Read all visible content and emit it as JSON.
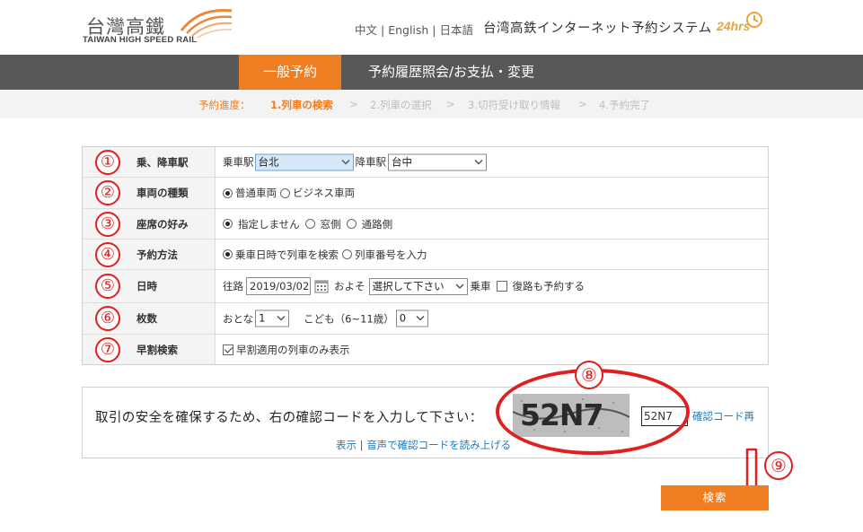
{
  "header": {
    "logo_cn": "台灣高鐵",
    "logo_en": "TAIWAN HIGH SPEED RAIL",
    "lang_zh": "中文",
    "lang_en": "English",
    "lang_ja": "日本語",
    "lang_sep": " | ",
    "system_title": "台湾高鉄インターネット予約システム",
    "hrs_badge": "24hrs"
  },
  "nav": {
    "active_tab": "一般予約",
    "other_tab": "予約履歴照会/お支払・変更"
  },
  "steps": {
    "label": "予約進度：",
    "step1": "1.列車の検索",
    "step2": "2.列車の選択",
    "step3": "3.切符受け取り情報",
    "step4": "4.予約完了",
    "separator": ">"
  },
  "form": {
    "rows": [
      {
        "num": "①",
        "label": "乗、降車駅"
      },
      {
        "num": "②",
        "label": "車両の種類"
      },
      {
        "num": "③",
        "label": "座席の好み"
      },
      {
        "num": "④",
        "label": "予約方法"
      },
      {
        "num": "⑤",
        "label": "日時"
      },
      {
        "num": "⑥",
        "label": "枚数"
      },
      {
        "num": "⑦",
        "label": "早割検索"
      }
    ],
    "stations": {
      "from_label": "乗車駅",
      "from_value": "台北",
      "to_label": "降車駅",
      "to_value": "台中"
    },
    "car_type": {
      "standard": "普通車両",
      "business": "ビジネス車両"
    },
    "seat": {
      "none": "指定しません",
      "window": "窓側",
      "aisle": "通路側"
    },
    "method": {
      "by_time": "乗車日時で列車を検索",
      "by_number": "列車番号を入力"
    },
    "datetime": {
      "outbound_label": "往路",
      "date_value": "2019/03/02",
      "approx_label": "およそ",
      "time_value": "選択して下さい",
      "board_label": "乗車",
      "return_label": "復路も予約する"
    },
    "tickets": {
      "adult_label": "おとな",
      "adult_value": "1",
      "child_label": "こども（6~11歳）",
      "child_value": "0"
    },
    "early": {
      "label": "早割適用の列車のみ表示"
    }
  },
  "captcha": {
    "instruction": "取引の安全を確保するため、右の確認コードを入力して下さい：",
    "image_text": "52N7",
    "input_value": "52N7",
    "refresh_label": "確認コード再",
    "show_label": "表示",
    "audio_label": "音声で確認コードを読み上げる",
    "link_sep": " | "
  },
  "annotations": {
    "num8": "⑧",
    "num9": "⑨"
  },
  "actions": {
    "search_label": "検索"
  },
  "colors": {
    "accent": "#ef7d22",
    "nav_bg": "#57585a",
    "annotation_red": "#e02020",
    "link_blue": "#1f7bb8"
  }
}
